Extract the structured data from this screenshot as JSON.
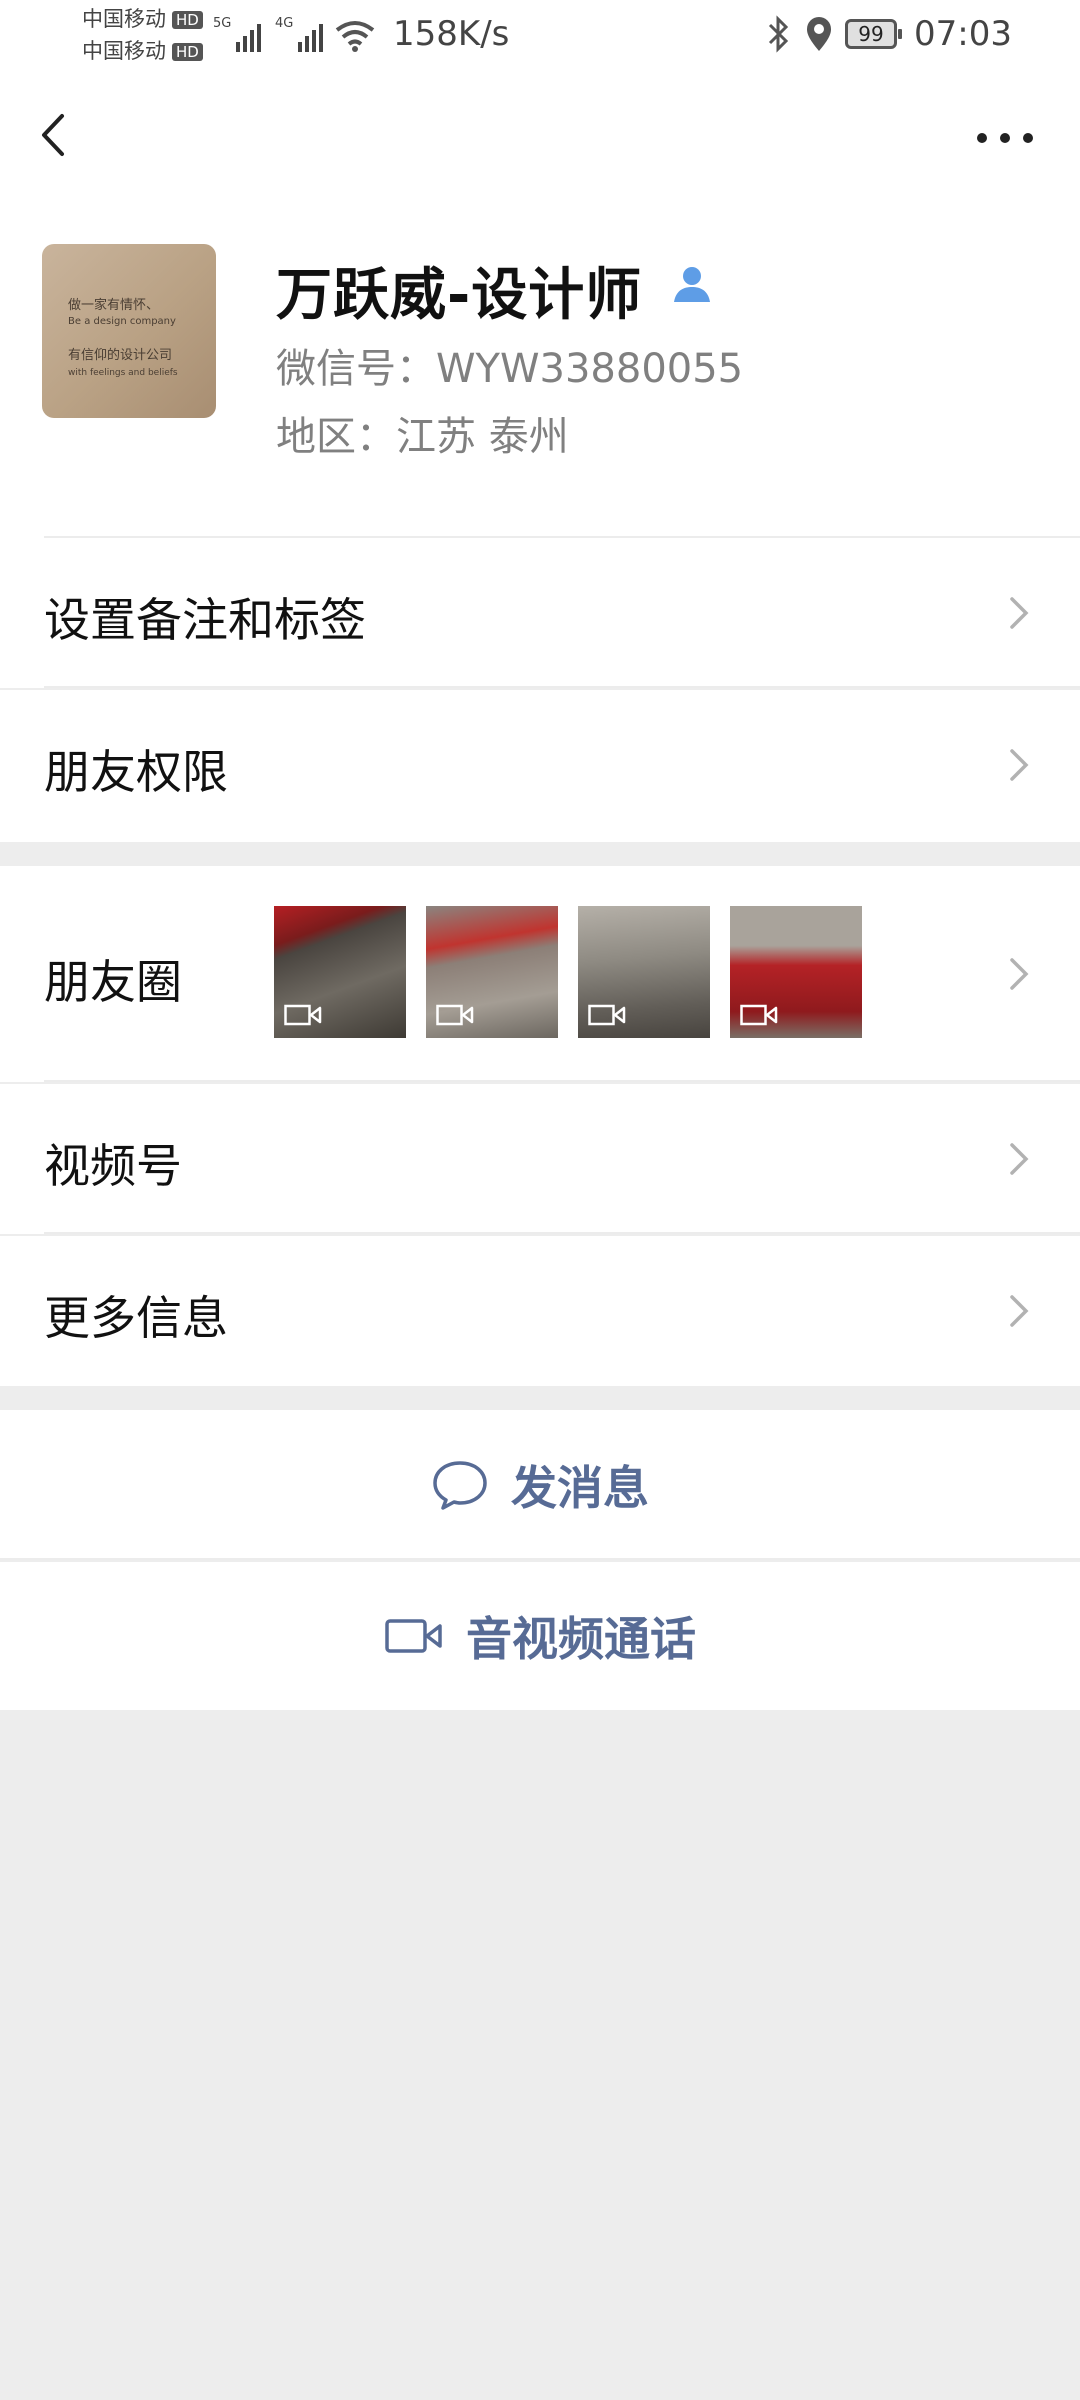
{
  "status_bar": {
    "carrier_1": "中国移动",
    "carrier_2": "中国移动",
    "hd_badge": "HD",
    "net_1": "5G",
    "net_2": "4G",
    "speed": "158K/s",
    "battery": "99",
    "time": "07:03"
  },
  "header": {
    "back_icon": "chevron-left-icon",
    "more_icon": "more-dots-icon"
  },
  "profile": {
    "avatar_text": [
      "做一家有情怀、",
      "Be a design company",
      "有信仰的设计公司",
      "with feelings and beliefs"
    ],
    "name": "万跃威-设计师",
    "wechat_id": "微信号：WYW33880055",
    "region": "地区：江苏  泰州"
  },
  "rows": {
    "remarks": "设置备注和标签",
    "permissions": "朋友权限",
    "moments": "朋友圈",
    "channels": "视频号",
    "more_info": "更多信息"
  },
  "actions": {
    "message": "发消息",
    "call": "音视频通话"
  },
  "colors": {
    "link_blue": "#576b95",
    "background": "#ededed",
    "contact_icon": "#5e9de6"
  }
}
